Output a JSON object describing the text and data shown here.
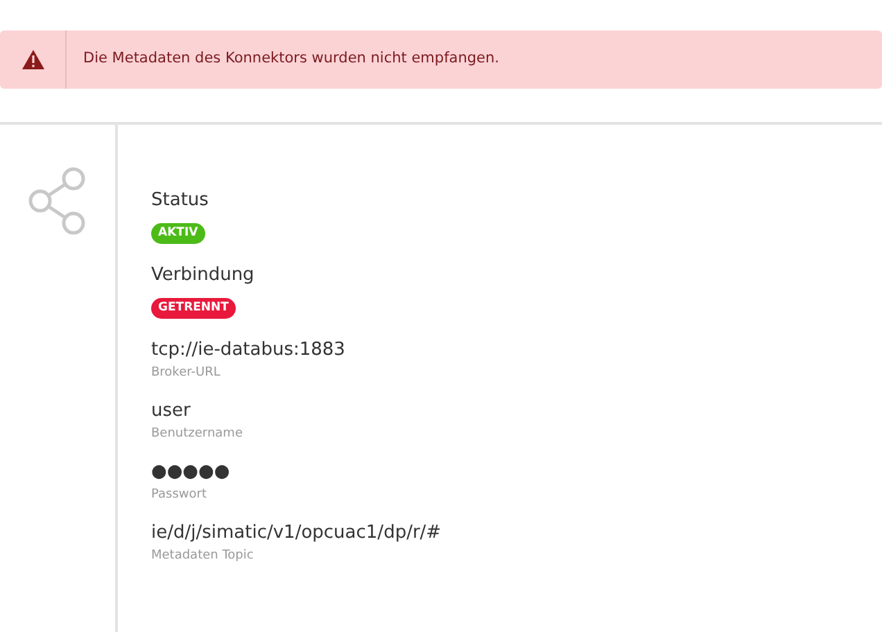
{
  "alert": {
    "message": "Die Metadaten des Konnektors wurden nicht empfangen."
  },
  "fields": [
    {
      "kind": "badge",
      "label": "Status",
      "badge": "AKTIV",
      "color": "#4cbb17"
    },
    {
      "kind": "badge",
      "label": "Verbindung",
      "badge": "GETRENNT",
      "color": "#e8193c"
    },
    {
      "kind": "value",
      "value": "tcp://ie-databus:1883",
      "caption": "Broker-URL"
    },
    {
      "kind": "value",
      "value": "user",
      "caption": "Benutzername"
    },
    {
      "kind": "value",
      "value": "●●●●●",
      "caption": "Passwort"
    },
    {
      "kind": "value",
      "value": "ie/d/j/simatic/v1/opcuac1/dp/r/#",
      "caption": "Metadaten Topic"
    }
  ]
}
